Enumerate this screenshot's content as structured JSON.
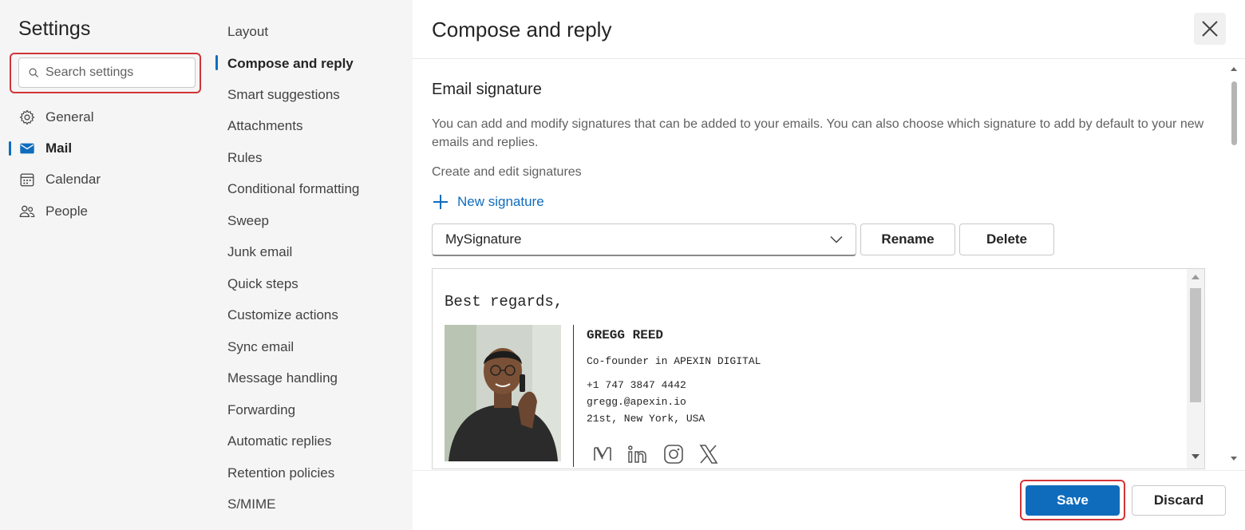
{
  "settings": {
    "title": "Settings",
    "search_placeholder": "Search settings"
  },
  "nav": {
    "items": [
      {
        "label": "General",
        "icon": "gear-icon"
      },
      {
        "label": "Mail",
        "icon": "mail-icon"
      },
      {
        "label": "Calendar",
        "icon": "calendar-icon"
      },
      {
        "label": "People",
        "icon": "people-icon"
      }
    ]
  },
  "subnav": {
    "items": [
      "Layout",
      "Compose and reply",
      "Smart suggestions",
      "Attachments",
      "Rules",
      "Conditional formatting",
      "Sweep",
      "Junk email",
      "Quick steps",
      "Customize actions",
      "Sync email",
      "Message handling",
      "Forwarding",
      "Automatic replies",
      "Retention policies",
      "S/MIME"
    ]
  },
  "pane": {
    "title": "Compose and reply",
    "section_title": "Email signature",
    "description": "You can add and modify signatures that can be added to your emails. You can also choose which signature to add by default to your new emails and replies.",
    "create_label": "Create and edit signatures",
    "new_signature": "New signature",
    "selected_signature": "MySignature",
    "rename": "Rename",
    "delete": "Delete"
  },
  "signature": {
    "greeting": "Best regards,",
    "name": "GREGG REED",
    "role": "Co-founder  in APEXIN DIGITAL",
    "phone": "+1 747 3847 4442",
    "email": "gregg.@apexin.io",
    "address": "21st, New York, USA",
    "social_icons": [
      "medium-icon",
      "linkedin-icon",
      "instagram-icon",
      "x-icon"
    ]
  },
  "footer": {
    "save": "Save",
    "discard": "Discard"
  },
  "colors": {
    "accent": "#0f6cbd",
    "highlight": "#d13438"
  }
}
